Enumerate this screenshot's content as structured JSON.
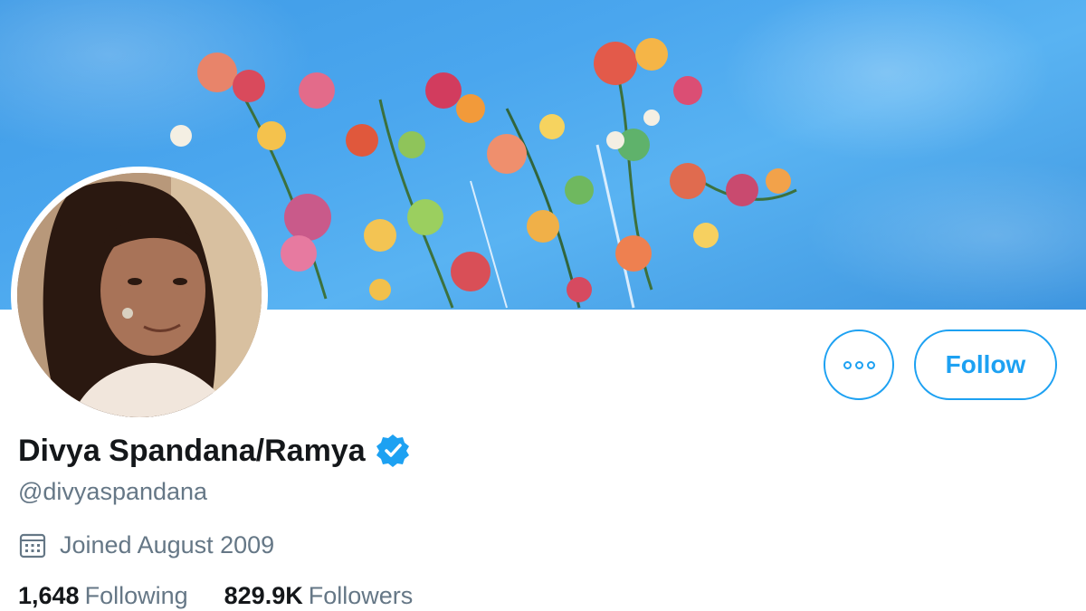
{
  "profile": {
    "display_name": "Divya Spandana/Ramya",
    "handle": "@divyaspandana",
    "joined": "Joined August 2009",
    "following_count": "1,648",
    "following_label": "Following",
    "followers_count": "829.9K",
    "followers_label": "Followers"
  },
  "actions": {
    "follow_label": "Follow"
  },
  "icons": {
    "more": "more-options-icon",
    "verified": "verified-badge-icon",
    "calendar": "calendar-icon"
  },
  "colors": {
    "accent": "#1da1f2",
    "text_primary": "#14171a",
    "text_secondary": "#657786"
  }
}
